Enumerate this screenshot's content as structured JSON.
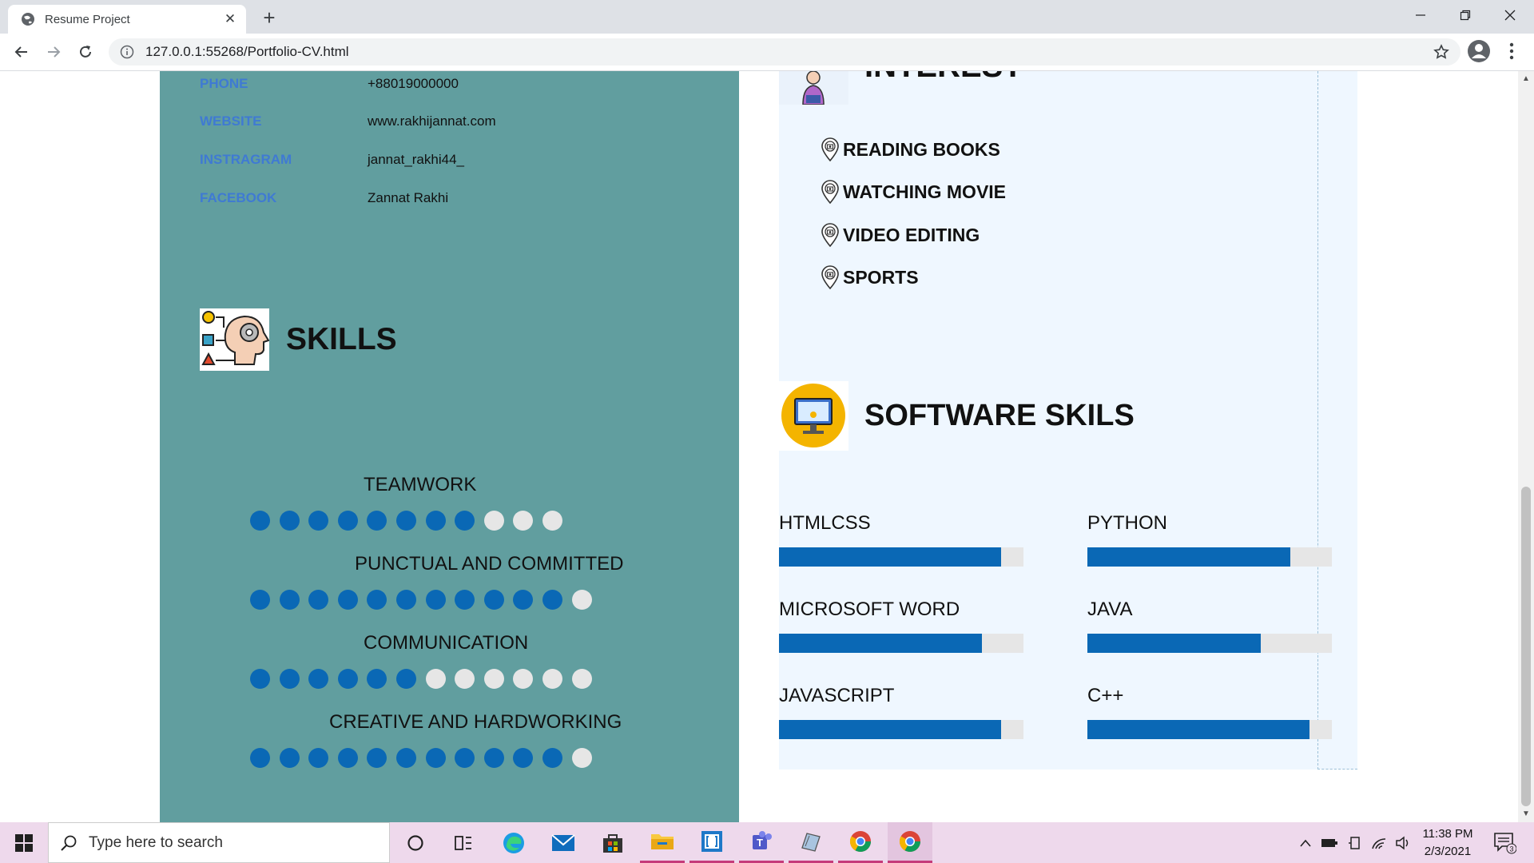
{
  "browser": {
    "tab_title": "Resume Project",
    "url": "127.0.0.1:55268/Portfolio-CV.html"
  },
  "contact": [
    {
      "label": "PHONE",
      "value": "+88019000000"
    },
    {
      "label": "WEBSITE",
      "value": "www.rakhijannat.com"
    },
    {
      "label": "INSTRAGRAM",
      "value": "jannat_rakhi44_"
    },
    {
      "label": "FACEBOOK",
      "value": "Zannat Rakhi"
    }
  ],
  "skills": {
    "title": "SKILLS",
    "items": [
      {
        "name": "TEAMWORK",
        "filled": 8,
        "total": 11
      },
      {
        "name": "PUNCTUAL AND COMMITTED",
        "filled": 11,
        "total": 12
      },
      {
        "name": "COMMUNICATION",
        "filled": 6,
        "total": 12
      },
      {
        "name": "CREATIVE AND HARDWORKING",
        "filled": 11,
        "total": 12
      }
    ]
  },
  "interest": {
    "title": "INTEREST",
    "items": [
      "READING BOOKS",
      "WATCHING MOVIE",
      "VIDEO EDITING",
      "SPORTS"
    ]
  },
  "software": {
    "title": "SOFTWARE SKILS",
    "items": [
      {
        "name": "HTMLCSS",
        "percent": 91
      },
      {
        "name": "PYTHON",
        "percent": 83
      },
      {
        "name": "MICROSOFT WORD",
        "percent": 83
      },
      {
        "name": "JAVA",
        "percent": 71
      },
      {
        "name": "JAVASCRIPT",
        "percent": 91
      },
      {
        "name": "C++",
        "percent": 91
      }
    ]
  },
  "taskbar": {
    "search_placeholder": "Type here to search",
    "time": "11:38 PM",
    "date": "2/3/2021",
    "notifications": "3"
  },
  "colors": {
    "left_panel": "#619e9f",
    "accent_blue": "#0a68b5",
    "contact_label": "#3f7ad3",
    "right_panel": "#eff7ff"
  }
}
